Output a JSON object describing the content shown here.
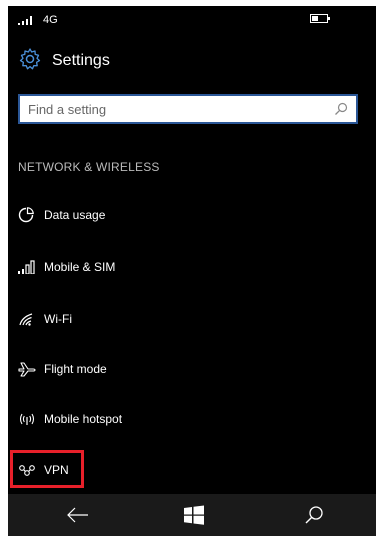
{
  "status_bar": {
    "network": "4G",
    "signal_icon": "signal-bars-icon",
    "battery_icon": "battery-icon"
  },
  "header": {
    "icon": "gear-icon",
    "title": "Settings"
  },
  "search": {
    "placeholder": "Find a setting",
    "icon": "search-icon"
  },
  "section": {
    "label": "NETWORK & WIRELESS"
  },
  "menu": {
    "items": [
      {
        "label": "Data usage",
        "icon": "pie-chart-icon"
      },
      {
        "label": "Mobile & SIM",
        "icon": "signal-bars-icon"
      },
      {
        "label": "Wi-Fi",
        "icon": "wifi-icon"
      },
      {
        "label": "Flight mode",
        "icon": "airplane-icon"
      },
      {
        "label": "Mobile hotspot",
        "icon": "hotspot-icon"
      },
      {
        "label": "VPN",
        "icon": "vpn-icon"
      }
    ]
  },
  "highlight": {
    "color": "#e8202a",
    "target": "VPN"
  },
  "nav_bar": {
    "buttons": [
      "back-icon",
      "windows-icon",
      "search-icon"
    ]
  },
  "colors": {
    "background": "#000000",
    "accent": "#2b5797",
    "text": "#ffffff",
    "section": "#bbbbbb"
  }
}
